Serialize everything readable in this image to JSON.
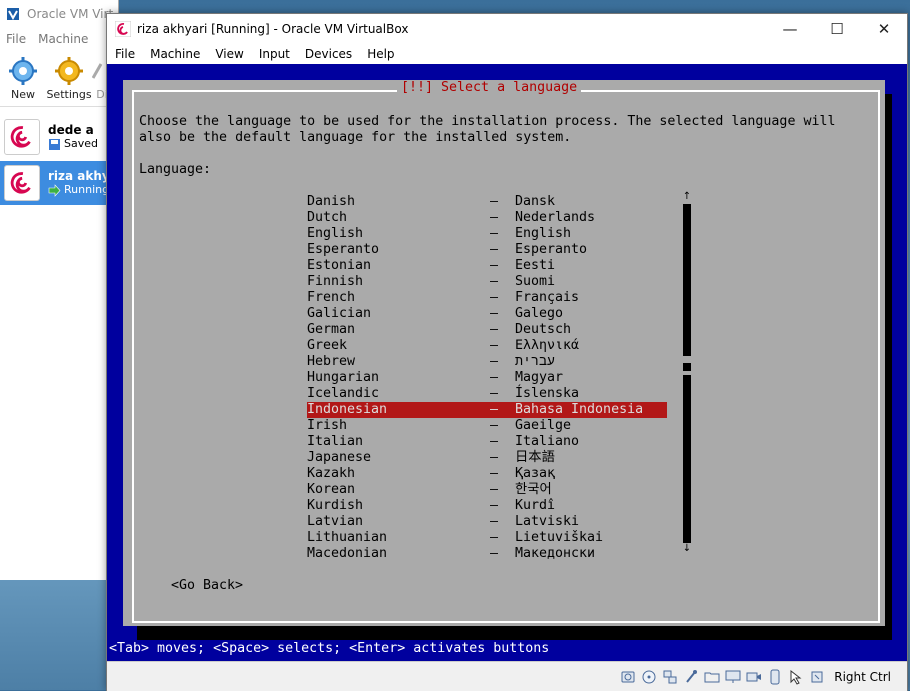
{
  "manager": {
    "title": "Oracle VM VirtualBox Manager",
    "title_visible": "Oracle VM Virt",
    "menu": [
      "File",
      "Machine"
    ],
    "toolbar": [
      {
        "label": "New",
        "icon": "new-icon"
      },
      {
        "label": "Settings",
        "icon": "gear-icon"
      },
      {
        "label": "Di",
        "icon": "discard-icon"
      }
    ],
    "vms": [
      {
        "name": "dede a",
        "state": "Saved",
        "state_icon": "saved-icon",
        "selected": false
      },
      {
        "name": "riza akhya",
        "state": "Running",
        "state_icon": "running-arrow-icon",
        "selected": true
      }
    ]
  },
  "window": {
    "title": "riza akhyari [Running] - Oracle VM VirtualBox",
    "controls": {
      "minimize": "—",
      "maximize": "☐",
      "close": "✕"
    },
    "menu": [
      "File",
      "Machine",
      "View",
      "Input",
      "Devices",
      "Help"
    ]
  },
  "installer": {
    "dialog_title": "[!!] Select a language",
    "description_line1": "Choose the language to be used for the installation process. The selected language will",
    "description_line2": "also be the default language for the installed system.",
    "label": "Language:",
    "languages": [
      {
        "english": "Danish",
        "native": "Dansk"
      },
      {
        "english": "Dutch",
        "native": "Nederlands"
      },
      {
        "english": "English",
        "native": "English"
      },
      {
        "english": "Esperanto",
        "native": "Esperanto"
      },
      {
        "english": "Estonian",
        "native": "Eesti"
      },
      {
        "english": "Finnish",
        "native": "Suomi"
      },
      {
        "english": "French",
        "native": "Français"
      },
      {
        "english": "Galician",
        "native": "Galego"
      },
      {
        "english": "German",
        "native": "Deutsch"
      },
      {
        "english": "Greek",
        "native": "Ελληνικά"
      },
      {
        "english": "Hebrew",
        "native": "עברית"
      },
      {
        "english": "Hungarian",
        "native": "Magyar"
      },
      {
        "english": "Icelandic",
        "native": "Íslenska"
      },
      {
        "english": "Indonesian",
        "native": "Bahasa Indonesia",
        "selected": true
      },
      {
        "english": "Irish",
        "native": "Gaeilge"
      },
      {
        "english": "Italian",
        "native": "Italiano"
      },
      {
        "english": "Japanese",
        "native": "日本語"
      },
      {
        "english": "Kazakh",
        "native": "Қазақ"
      },
      {
        "english": "Korean",
        "native": "한국어"
      },
      {
        "english": "Kurdish",
        "native": "Kurdî"
      },
      {
        "english": "Latvian",
        "native": "Latviski"
      },
      {
        "english": "Lithuanian",
        "native": "Lietuviškai"
      },
      {
        "english": "Macedonian",
        "native": "Македонски"
      }
    ],
    "separator": "–",
    "scroll_up": "↑",
    "scroll_down": "↓",
    "go_back": "<Go Back>",
    "hint": "<Tab> moves; <Space> selects; <Enter> activates buttons"
  },
  "statusbar": {
    "icons": [
      "hard-disk-icon",
      "optical-disk-icon",
      "network-icon",
      "usb-icon",
      "shared-folder-icon",
      "display-icon",
      "recording-icon",
      "capture-icon",
      "mouse-integration-icon",
      "keyboard-icon"
    ],
    "host_key": "Right Ctrl"
  },
  "colors": {
    "installer_bg": "#00009e",
    "dialog_bg": "#aaaaaa",
    "selection": "#b21818",
    "title_red": "#b00000",
    "manager_selection": "#3d8ce0"
  }
}
